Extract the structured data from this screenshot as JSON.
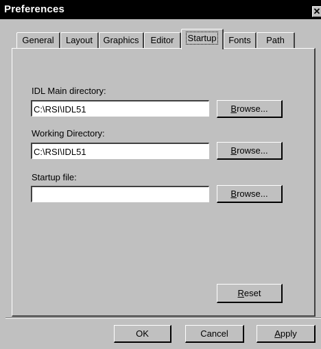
{
  "window": {
    "title": "Preferences",
    "close_glyph": "✕"
  },
  "tabs": [
    {
      "label": "General"
    },
    {
      "label": "Layout"
    },
    {
      "label": "Graphics"
    },
    {
      "label": "Editor"
    },
    {
      "label": "Startup",
      "active": true
    },
    {
      "label": "Fonts"
    },
    {
      "label": "Path"
    }
  ],
  "startup": {
    "main_dir_label": "IDL Main directory:",
    "main_dir_value": "C:\\RSI\\IDL51",
    "working_dir_label": "Working Directory:",
    "working_dir_value": "C:\\RSI\\IDL51",
    "startup_file_label": "Startup file:",
    "startup_file_value": "",
    "browse": {
      "mnemonic": "B",
      "rest": "rowse..."
    },
    "reset": {
      "mnemonic": "R",
      "rest": "eset"
    }
  },
  "footer": {
    "ok_label": "OK",
    "cancel_label": "Cancel",
    "apply": {
      "mnemonic": "A",
      "rest": "pply"
    }
  },
  "colors": {
    "face": "#c0c0c0",
    "titlebar": "#000000",
    "title_text": "#ffffff"
  }
}
